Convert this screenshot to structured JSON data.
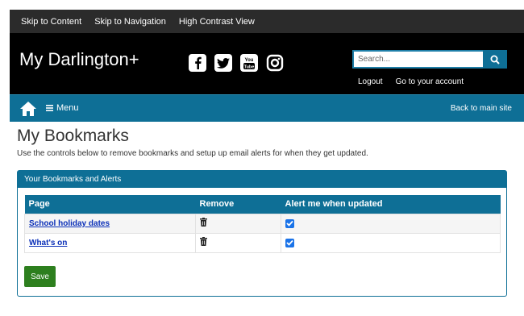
{
  "skip_links": [
    "Skip to Content",
    "Skip to Navigation",
    "High Contrast View"
  ],
  "site_title": "My Darlington+",
  "social_icons": [
    "facebook-icon",
    "twitter-icon",
    "youtube-icon",
    "instagram-icon"
  ],
  "search": {
    "placeholder": "Search..."
  },
  "account": {
    "logout": "Logout",
    "go_to_account": "Go to your account"
  },
  "nav": {
    "menu_label": "Menu",
    "back_label": "Back to main site"
  },
  "page": {
    "title": "My Bookmarks",
    "intro": "Use the controls below to remove bookmarks and setup up email alerts for when they get updated."
  },
  "panel": {
    "title": "Your Bookmarks and Alerts",
    "columns": [
      "Page",
      "Remove",
      "Alert me when updated"
    ],
    "rows": [
      {
        "page": "School holiday dates",
        "alert": true
      },
      {
        "page": "What's on",
        "alert": true
      }
    ],
    "save_label": "Save"
  },
  "colors": {
    "brand_blue": "#0e6f96",
    "header_black": "#000000",
    "save_green": "#2d7f1e",
    "link_blue": "#0a2fb8"
  }
}
